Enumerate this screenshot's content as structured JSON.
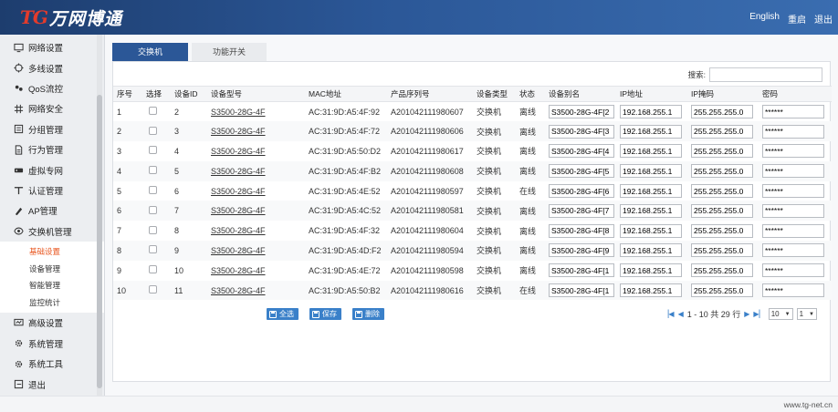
{
  "header": {
    "logo_mark": "TG",
    "logo_text": "万网博通",
    "links": [
      "English",
      "重启",
      "退出"
    ]
  },
  "sidebar": {
    "items": [
      {
        "label": "网络设置",
        "icon": "monitor-icon"
      },
      {
        "label": "多线设置",
        "icon": "crosshair-icon"
      },
      {
        "label": "QoS流控",
        "icon": "qos-icon"
      },
      {
        "label": "网络安全",
        "icon": "shield-icon"
      },
      {
        "label": "分组管理",
        "icon": "group-icon"
      },
      {
        "label": "行为管理",
        "icon": "document-icon"
      },
      {
        "label": "虚拟专网",
        "icon": "vpn-icon"
      },
      {
        "label": "认证管理",
        "icon": "auth-icon"
      },
      {
        "label": "AP管理",
        "icon": "ap-icon"
      },
      {
        "label": "交换机管理",
        "icon": "switch-icon"
      }
    ],
    "submenu": [
      {
        "label": "基础设置",
        "active": true
      },
      {
        "label": "设备管理",
        "active": false
      },
      {
        "label": "智能管理",
        "active": false
      },
      {
        "label": "监控统计",
        "active": false
      }
    ],
    "bottom_items": [
      {
        "label": "高级设置",
        "icon": "advanced-icon"
      },
      {
        "label": "系统管理",
        "icon": "gear-icon"
      },
      {
        "label": "系统工具",
        "icon": "tools-icon"
      },
      {
        "label": "退出",
        "icon": "exit-icon"
      }
    ]
  },
  "tabs": [
    "交换机",
    "功能开关"
  ],
  "search": {
    "label": "搜索:",
    "value": ""
  },
  "table": {
    "headers": [
      "序号",
      "选择",
      "设备ID",
      "设备型号",
      "MAC地址",
      "产品序列号",
      "设备类型",
      "状态",
      "设备别名",
      "IP地址",
      "IP掩码",
      "密码"
    ],
    "rows": [
      {
        "no": "1",
        "id": "2",
        "model": "S3500-28G-4F",
        "mac": "AC:31:9D:A5:4F:92",
        "serial": "A201042111980607",
        "type": "交换机",
        "status": "离线",
        "alias": "S3500-28G-4F[2",
        "ip": "192.168.255.1",
        "mask": "255.255.255.0",
        "pwd": "******"
      },
      {
        "no": "2",
        "id": "3",
        "model": "S3500-28G-4F",
        "mac": "AC:31:9D:A5:4F:72",
        "serial": "A201042111980606",
        "type": "交换机",
        "status": "离线",
        "alias": "S3500-28G-4F[3",
        "ip": "192.168.255.1",
        "mask": "255.255.255.0",
        "pwd": "******"
      },
      {
        "no": "3",
        "id": "4",
        "model": "S3500-28G-4F",
        "mac": "AC:31:9D:A5:50:D2",
        "serial": "A201042111980617",
        "type": "交换机",
        "status": "离线",
        "alias": "S3500-28G-4F[4",
        "ip": "192.168.255.1",
        "mask": "255.255.255.0",
        "pwd": "******"
      },
      {
        "no": "4",
        "id": "5",
        "model": "S3500-28G-4F",
        "mac": "AC:31:9D:A5:4F:B2",
        "serial": "A201042111980608",
        "type": "交换机",
        "status": "离线",
        "alias": "S3500-28G-4F[5",
        "ip": "192.168.255.1",
        "mask": "255.255.255.0",
        "pwd": "******"
      },
      {
        "no": "5",
        "id": "6",
        "model": "S3500-28G-4F",
        "mac": "AC:31:9D:A5:4E:52",
        "serial": "A201042111980597",
        "type": "交换机",
        "status": "在线",
        "alias": "S3500-28G-4F[6",
        "ip": "192.168.255.1",
        "mask": "255.255.255.0",
        "pwd": "******"
      },
      {
        "no": "6",
        "id": "7",
        "model": "S3500-28G-4F",
        "mac": "AC:31:9D:A5:4C:52",
        "serial": "A201042111980581",
        "type": "交换机",
        "status": "离线",
        "alias": "S3500-28G-4F[7",
        "ip": "192.168.255.1",
        "mask": "255.255.255.0",
        "pwd": "******"
      },
      {
        "no": "7",
        "id": "8",
        "model": "S3500-28G-4F",
        "mac": "AC:31:9D:A5:4F:32",
        "serial": "A201042111980604",
        "type": "交换机",
        "status": "离线",
        "alias": "S3500-28G-4F[8",
        "ip": "192.168.255.1",
        "mask": "255.255.255.0",
        "pwd": "******"
      },
      {
        "no": "8",
        "id": "9",
        "model": "S3500-28G-4F",
        "mac": "AC:31:9D:A5:4D:F2",
        "serial": "A201042111980594",
        "type": "交换机",
        "status": "离线",
        "alias": "S3500-28G-4F[9",
        "ip": "192.168.255.1",
        "mask": "255.255.255.0",
        "pwd": "******"
      },
      {
        "no": "9",
        "id": "10",
        "model": "S3500-28G-4F",
        "mac": "AC:31:9D:A5:4E:72",
        "serial": "A201042111980598",
        "type": "交换机",
        "status": "离线",
        "alias": "S3500-28G-4F[1",
        "ip": "192.168.255.1",
        "mask": "255.255.255.0",
        "pwd": "******"
      },
      {
        "no": "10",
        "id": "11",
        "model": "S3500-28G-4F",
        "mac": "AC:31:9D:A5:50:B2",
        "serial": "A201042111980616",
        "type": "交换机",
        "status": "在线",
        "alias": "S3500-28G-4F[1",
        "ip": "192.168.255.1",
        "mask": "255.255.255.0",
        "pwd": "******"
      }
    ]
  },
  "actions": {
    "select_all": "全选",
    "save": "保存",
    "delete": "删除"
  },
  "pager": {
    "info": "1 - 10 共 29 行",
    "page_size": "10",
    "page": "1"
  },
  "footer": {
    "url": "www.tg-net.cn"
  }
}
